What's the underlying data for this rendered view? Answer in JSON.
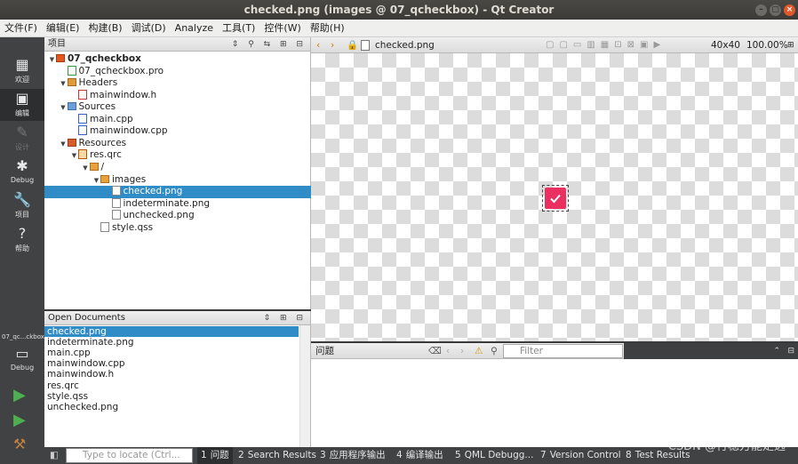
{
  "window": {
    "title": "checked.png (images @ 07_qcheckbox) - Qt Creator"
  },
  "menu": [
    "文件(F)",
    "编辑(E)",
    "构建(B)",
    "调试(D)",
    "Analyze",
    "工具(T)",
    "控件(W)",
    "帮助(H)"
  ],
  "modes": [
    {
      "label": "欢迎",
      "icon": "grid-icon"
    },
    {
      "label": "编辑",
      "icon": "edit-icon"
    },
    {
      "label": "设计",
      "icon": "pencil-icon"
    },
    {
      "label": "Debug",
      "icon": "bug-icon"
    },
    {
      "label": "项目",
      "icon": "wrench-icon"
    },
    {
      "label": "帮助",
      "icon": "help-icon"
    }
  ],
  "kit": {
    "project_label": "07_qc...ckbox",
    "config_label": "Debug"
  },
  "projects_panel": {
    "title": "项目",
    "tree": [
      {
        "label": "07_qcheckbox",
        "type": "proj",
        "expanded": true,
        "bold": true
      },
      {
        "label": "07_qcheckbox.pro",
        "type": "pro"
      },
      {
        "label": "Headers",
        "type": "hdrfld",
        "expanded": true
      },
      {
        "label": "mainwindow.h",
        "type": "h"
      },
      {
        "label": "Sources",
        "type": "srcfld",
        "expanded": true
      },
      {
        "label": "main.cpp",
        "type": "cpp"
      },
      {
        "label": "mainwindow.cpp",
        "type": "cpp"
      },
      {
        "label": "Resources",
        "type": "resfld",
        "expanded": true
      },
      {
        "label": "res.qrc",
        "type": "lock",
        "expanded": true
      },
      {
        "label": "/",
        "type": "folder",
        "expanded": true
      },
      {
        "label": "images",
        "type": "folder",
        "expanded": true
      },
      {
        "label": "checked.png",
        "type": "file",
        "selected": true
      },
      {
        "label": "indeterminate.png",
        "type": "file"
      },
      {
        "label": "unchecked.png",
        "type": "file"
      },
      {
        "label": "style.qss",
        "type": "file"
      }
    ]
  },
  "open_documents": {
    "title": "Open Documents",
    "items": [
      "checked.png",
      "indeterminate.png",
      "main.cpp",
      "mainwindow.cpp",
      "mainwindow.h",
      "res.qrc",
      "style.qss",
      "unchecked.png"
    ],
    "selected_index": 0
  },
  "editor": {
    "file_name": "checked.png",
    "image_size": "40x40",
    "zoom": "100.00%",
    "image_color": "#ea2f61"
  },
  "issues": {
    "title": "问题",
    "filter_placeholder": "Filter"
  },
  "statusbar": {
    "locate_placeholder": "Type to locate (Ctrl...",
    "tabs": [
      {
        "num": "1",
        "label": "问题"
      },
      {
        "num": "2",
        "label": "Search Results"
      },
      {
        "num": "3",
        "label": "应用程序输出"
      },
      {
        "num": "4",
        "label": "编译输出"
      },
      {
        "num": "5",
        "label": "QML Debugg..."
      },
      {
        "num": "7",
        "label": "Version Control"
      },
      {
        "num": "8",
        "label": "Test Results"
      }
    ]
  },
  "watermark": "CSDN @行稳方能走远"
}
